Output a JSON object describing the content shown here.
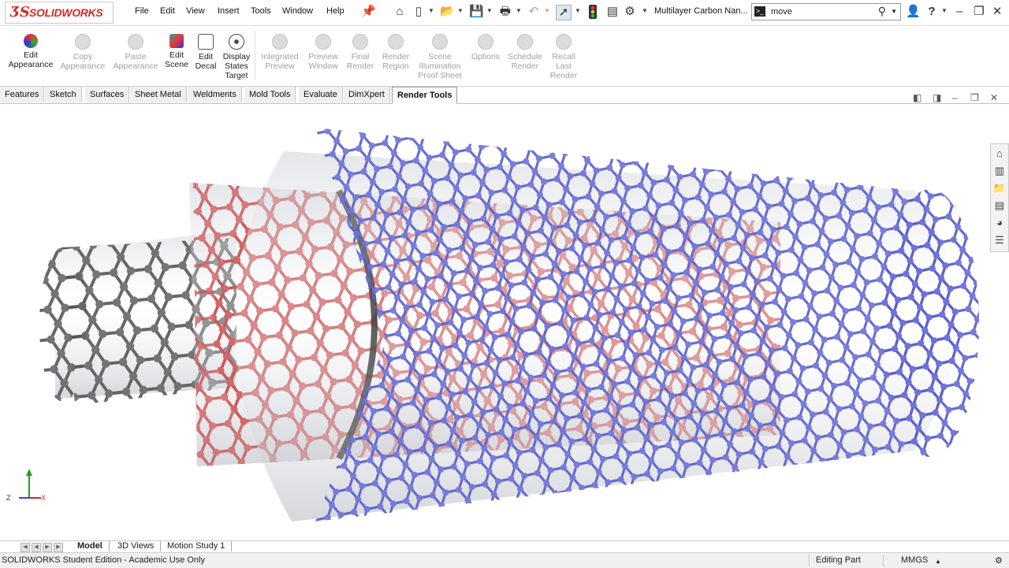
{
  "app": {
    "logo_text": "SOLIDWORKS",
    "document_title": "Multilayer Carbon Nan...",
    "search_value": "move"
  },
  "menu": [
    "File",
    "Edit",
    "View",
    "Insert",
    "Tools",
    "Window",
    "Help"
  ],
  "ribbon": {
    "buttons": [
      {
        "label": "Edit Appearance",
        "enabled": true
      },
      {
        "label": "Copy Appearance",
        "enabled": false
      },
      {
        "label": "Paste Appearance",
        "enabled": false
      },
      {
        "label": "Edit Scene",
        "enabled": true
      },
      {
        "label": "Edit Decal",
        "enabled": true
      },
      {
        "label": "Display States Target",
        "enabled": true
      },
      {
        "label": "Integrated Preview",
        "enabled": false
      },
      {
        "label": "Preview Window",
        "enabled": false
      },
      {
        "label": "Final Render",
        "enabled": false
      },
      {
        "label": "Render Region",
        "enabled": false
      },
      {
        "label": "Scene Illumination Proof Sheet",
        "enabled": false
      },
      {
        "label": "Options",
        "enabled": false
      },
      {
        "label": "Schedule Render",
        "enabled": false
      },
      {
        "label": "Recall Last Render",
        "enabled": false
      }
    ]
  },
  "tabs": [
    "Features",
    "Sketch",
    "Surfaces",
    "Sheet Metal",
    "Weldments",
    "Mold Tools",
    "Evaluate",
    "DimXpert",
    "Render Tools"
  ],
  "active_tab": "Render Tools",
  "bottom_tabs": [
    "Model",
    "3D Views",
    "Motion Study 1"
  ],
  "status": {
    "edition": "SOLIDWORKS Student Edition - Academic Use Only",
    "mode": "Editing Part",
    "units": "MMGS"
  },
  "triad": {
    "z": "Z",
    "x": "X"
  },
  "colors": {
    "brand_red": "#d52b1e",
    "outer_tube": "#5a5fc8",
    "middle_tube": "#c8585a",
    "inner_tube": "#5a5a5a"
  }
}
